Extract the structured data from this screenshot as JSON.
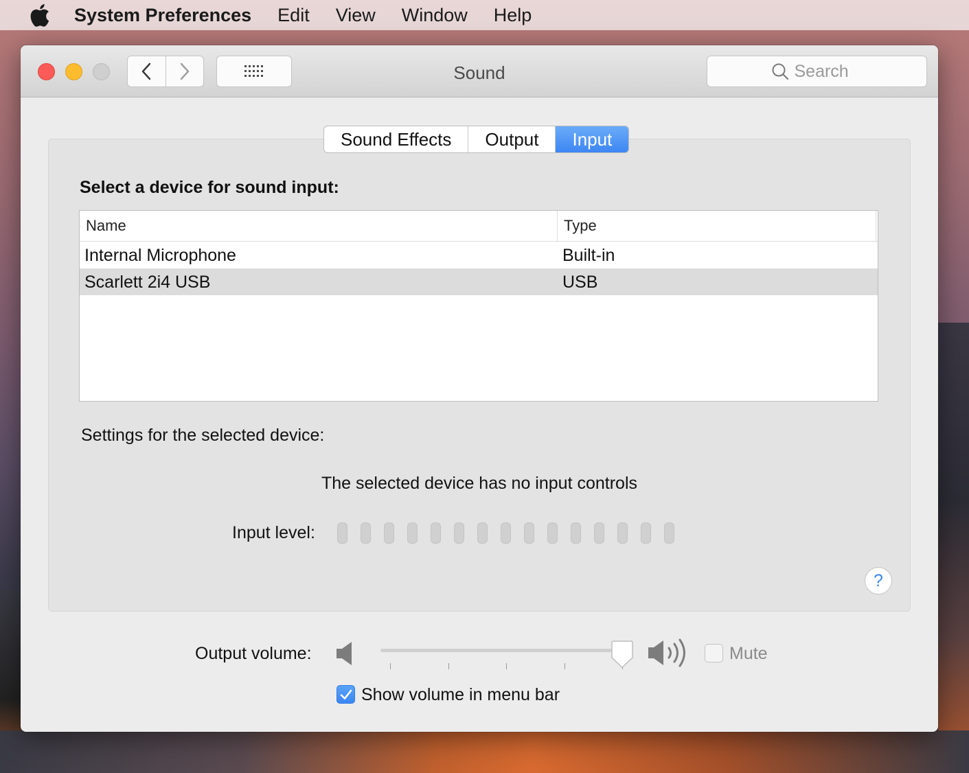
{
  "menubar": {
    "app_name": "System Preferences",
    "items": [
      "Edit",
      "View",
      "Window",
      "Help"
    ]
  },
  "window": {
    "title": "Sound",
    "search_placeholder": "Search"
  },
  "tabs": [
    {
      "label": "Sound Effects",
      "active": false
    },
    {
      "label": "Output",
      "active": false
    },
    {
      "label": "Input",
      "active": true
    }
  ],
  "input": {
    "section_title": "Select a device for sound input:",
    "columns": {
      "name": "Name",
      "type": "Type"
    },
    "devices": [
      {
        "name": "Internal Microphone",
        "type": "Built-in",
        "selected": false
      },
      {
        "name": "Scarlett 2i4 USB",
        "type": "USB",
        "selected": true
      }
    ],
    "settings_label": "Settings for the selected device:",
    "no_controls_text": "The selected device has no input controls",
    "input_level_label": "Input level:",
    "input_level_segments": 15,
    "input_level_active": 0
  },
  "help": {
    "label": "?"
  },
  "output_volume": {
    "label": "Output volume:",
    "value": 1.0,
    "mute_label": "Mute",
    "mute_checked": false
  },
  "show_volume": {
    "label": "Show volume in menu bar",
    "checked": true
  },
  "colors": {
    "accent": "#3d86f3",
    "close": "#fc5b57",
    "minimize": "#fdbc2e",
    "zoom_disabled": "#cfcfcf"
  }
}
